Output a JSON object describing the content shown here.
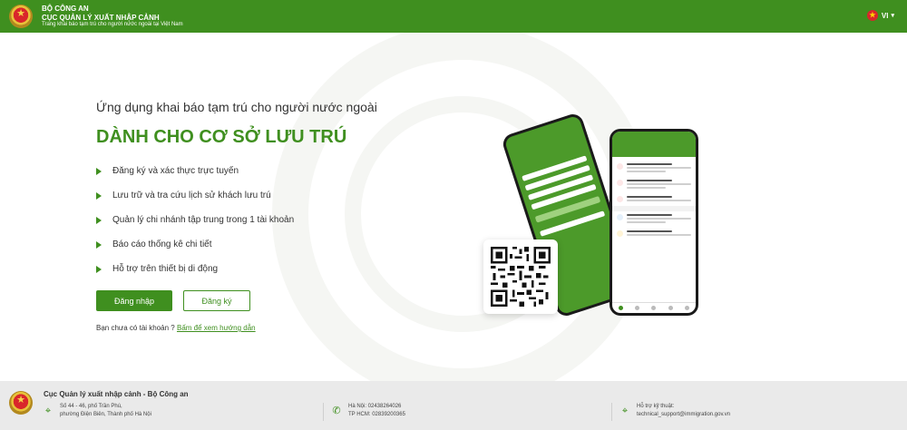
{
  "header": {
    "org_line1": "BỘ CÔNG AN",
    "org_line2": "CỤC QUẢN LÝ XUẤT NHẬP CẢNH",
    "org_line3": "Trang khai báo tạm trú cho người nước ngoài tại Việt Nam",
    "language": "VI"
  },
  "main": {
    "subtitle": "Ứng dụng khai báo tạm trú cho người nước ngoài",
    "headline": "DÀNH CHO CƠ SỞ LƯU TRÚ",
    "features": [
      "Đăng ký và xác thực trực tuyến",
      "Lưu trữ và tra cứu lịch sử khách lưu trú",
      "Quản lý chi nhánh tập trung trong 1 tài khoản",
      "Báo cáo thống kê chi tiết",
      "Hỗ trợ trên thiết bị di động"
    ],
    "login_button": "Đăng nhập",
    "register_button": "Đăng ký",
    "no_account_text": "Bạn chưa có tài khoản ?",
    "guide_link": "Bấm để xem hướng dẫn"
  },
  "footer": {
    "title": "Cục Quản lý xuất nhập cảnh - Bộ Công an",
    "address_line1": "Số 44 - 46, phố Trần Phú,",
    "address_line2": "phường Điện Biên, Thành phố Hà Nội",
    "phone_hanoi": "Hà Nội: 02438264026",
    "phone_hcm": "TP HCM: 02839200365",
    "support_label": "Hỗ trợ kỹ thuật:",
    "support_email": "technical_support@immigration.gov.vn"
  },
  "colors": {
    "brand_green": "#3f8f1f",
    "footer_bg": "#eaeaea"
  },
  "icons": [
    "emblem-icon",
    "vietnam-flag-icon",
    "chevron-down-icon",
    "location-icon",
    "phone-icon",
    "support-icon",
    "qr-code-icon"
  ]
}
